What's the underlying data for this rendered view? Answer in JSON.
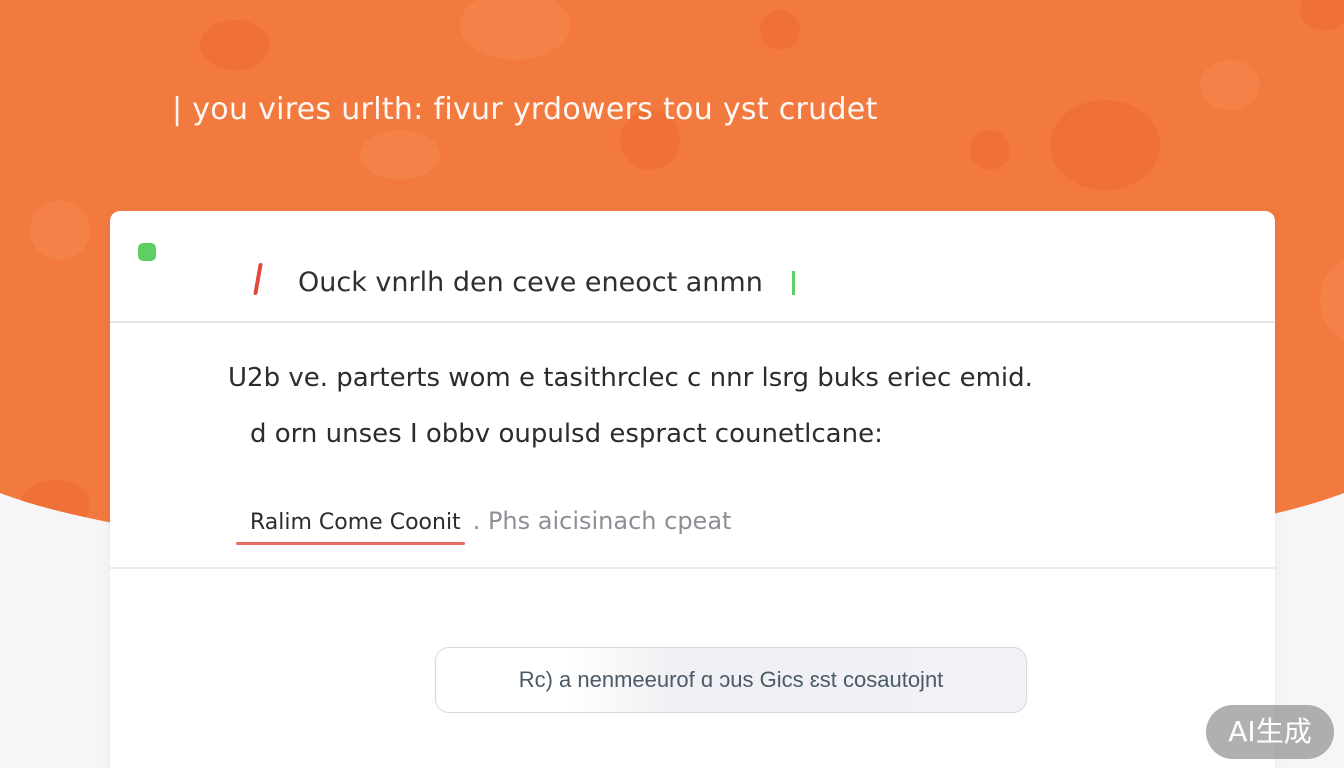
{
  "hero": {
    "headline": "| you vires urlth: fivur yrdowers tou yst crudet"
  },
  "card": {
    "title": "Ouck vnrlh den ceve eneoct anmn",
    "body_line_1": "U2b ve. parterts wom  e tasithrclec c nnr lsrg buks eriec emid.",
    "body_line_2": "d orn unses  I  obbv oupulsd espract counetlcane:",
    "link_label": "Ralim Come Coonit",
    "link_tail": ". Phs aicisinach cpeat",
    "button_label": "Rc) a nenmeeurof ɑ ɔus Gics  ɛst cosautojnt"
  },
  "watermark": "AI生成",
  "colors": {
    "hero_orange": "#f27a3f",
    "status_green": "#5fcf63",
    "accent_red": "#e2493a",
    "underline_red": "#e86a60"
  }
}
